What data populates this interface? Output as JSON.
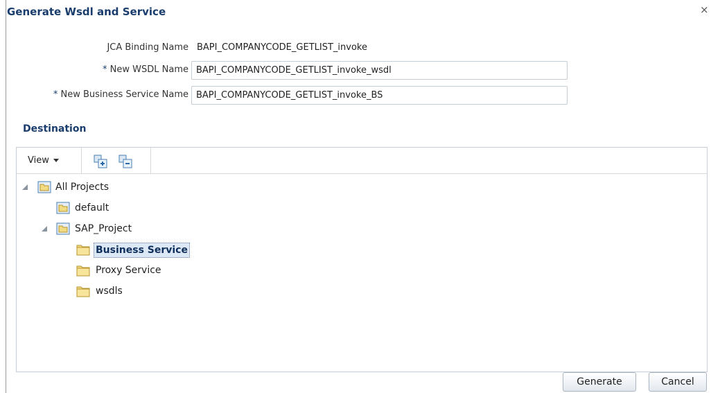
{
  "dialog": {
    "title": "Generate Wsdl and Service",
    "close_label": "×"
  },
  "form": {
    "jca_binding_label": "JCA Binding Name",
    "jca_binding_value": "BAPI_COMPANYCODE_GETLIST_invoke",
    "required_marker": "*",
    "wsdl_name_label": "New WSDL Name",
    "wsdl_name_value": "BAPI_COMPANYCODE_GETLIST_invoke_wsdl",
    "business_service_label": "New Business Service Name",
    "business_service_value": "BAPI_COMPANYCODE_GETLIST_invoke_BS"
  },
  "destination": {
    "title": "Destination",
    "view_menu_label": "View",
    "icons": {
      "expand_all": "expand-all-icon",
      "collapse_all": "collapse-all-icon"
    },
    "tree": [
      {
        "label": "All Projects",
        "type": "project",
        "expanded": true,
        "level": 0
      },
      {
        "label": "default",
        "type": "project",
        "level": 1
      },
      {
        "label": "SAP_Project",
        "type": "project",
        "expanded": true,
        "level": 1
      },
      {
        "label": "Business Service",
        "type": "folder",
        "selected": true,
        "level": 2
      },
      {
        "label": "Proxy Service",
        "type": "folder",
        "level": 2
      },
      {
        "label": "wsdls",
        "type": "folder",
        "level": 2
      }
    ]
  },
  "buttons": {
    "generate": "Generate",
    "cancel": "Cancel"
  },
  "colors": {
    "title": "#1a3d6d",
    "folder_fill": "#f2dc83",
    "project_icon": "#4a7fb5",
    "selection_bg": "#dce8f5"
  }
}
